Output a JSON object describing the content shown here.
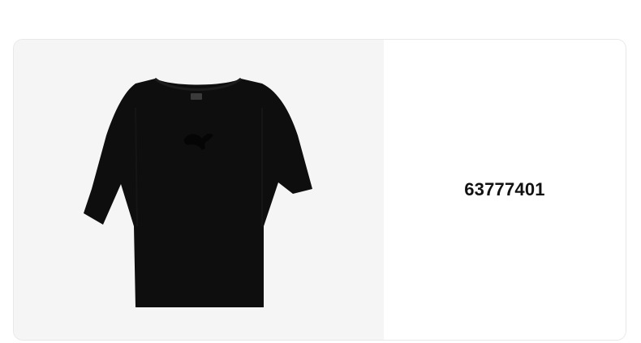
{
  "product": {
    "sku": "63777401",
    "image_alt": "Black t-shirt",
    "garment_color": "#0e0e0e",
    "logo_color": "#050505"
  },
  "colors": {
    "image_background": "#f5f5f5",
    "card_border": "#e8e8e8",
    "text": "#111111"
  },
  "icons": {
    "garment": "tshirt-icon",
    "brand": "brand-logo-icon"
  }
}
